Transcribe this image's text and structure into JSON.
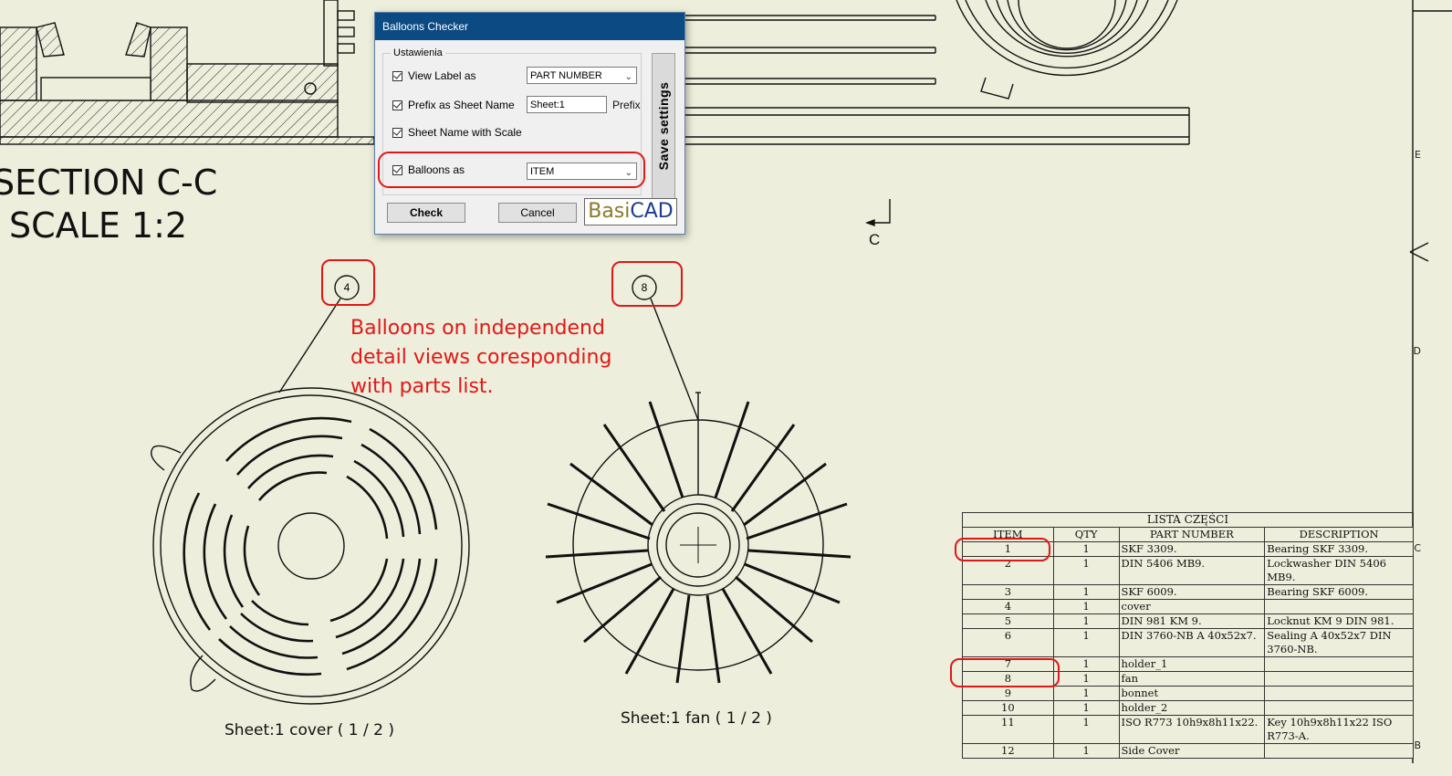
{
  "dialog": {
    "title": "Balloons Checker",
    "group_label": "Ustawienia",
    "view_label": {
      "label": "View Label as",
      "checked": true,
      "value": "PART NUMBER"
    },
    "prefix": {
      "label": "Prefix as Sheet Name",
      "checked": true,
      "value": "Sheet:1",
      "suffix": "Prefix"
    },
    "sheet_scale": {
      "label": "Sheet Name with Scale",
      "checked": true
    },
    "balloons_as": {
      "label": "Balloons as",
      "checked": true,
      "value": "ITEM"
    },
    "save_label": "Save settings",
    "check_label": "Check",
    "cancel_label": "Cancel",
    "logo": {
      "part1": "Basi",
      "part2": "CAD"
    }
  },
  "drawing": {
    "section_title": "SECTION C-C",
    "section_scale": "SCALE 1:2",
    "section_marker": "C",
    "annotation_lines": [
      "Balloons on independend",
      "detail views coresponding",
      "with parts list."
    ],
    "balloons": [
      "4",
      "8"
    ],
    "view_labels": [
      "Sheet:1  cover ( 1 / 2 )",
      "Sheet:1  fan ( 1 / 2 )"
    ],
    "border_letters": [
      "D",
      "C",
      "B",
      "E"
    ],
    "accent_color": "#e01818"
  },
  "parts_list": {
    "title": "LISTA CZĘŚCI",
    "headers": [
      "ITEM",
      "QTY",
      "PART NUMBER",
      "DESCRIPTION"
    ],
    "rows": [
      [
        "1",
        "1",
        " SKF 3309.",
        "Bearing SKF 3309."
      ],
      [
        "2",
        "1",
        "DIN 5406 MB9.",
        "Lockwasher DIN 5406 MB9."
      ],
      [
        "3",
        "1",
        " SKF 6009.",
        "Bearing SKF 6009."
      ],
      [
        "4",
        "1",
        "cover",
        ""
      ],
      [
        "5",
        "1",
        "DIN 981 KM  9.",
        "Locknut KM  9 DIN 981."
      ],
      [
        "6",
        "1",
        "DIN 3760-NB A 40x52x7.",
        "Sealing A 40x52x7 DIN 3760-NB."
      ],
      [
        "7",
        "1",
        "holder_1",
        ""
      ],
      [
        "8",
        "1",
        "fan",
        ""
      ],
      [
        "9",
        "1",
        "bonnet",
        ""
      ],
      [
        "10",
        "1",
        "holder_2",
        ""
      ],
      [
        "11",
        "1",
        "ISO R773 10h9x8h11x22.",
        "Key 10h9x8h11x22 ISO R773-A."
      ],
      [
        "12",
        "1",
        "Side Cover",
        ""
      ]
    ]
  }
}
